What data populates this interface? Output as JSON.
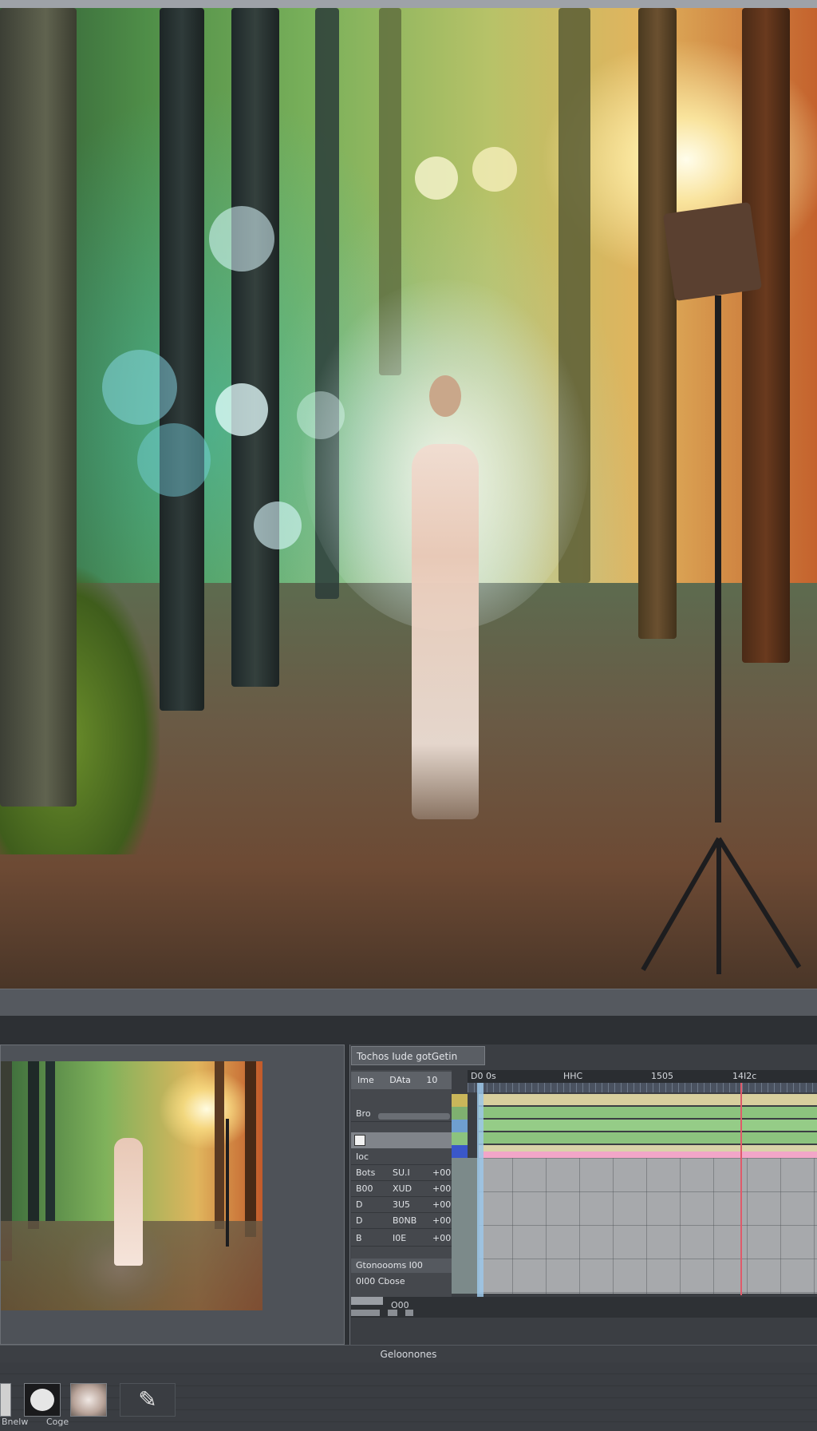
{
  "timeline": {
    "panel_title": "Tochos Iude gotGetin",
    "tabs": [
      "Ime",
      "DAta",
      "10"
    ],
    "props": [
      {
        "k": "Bro",
        "v": "",
        "u": ""
      },
      {
        "k": "Ioc",
        "v": "",
        "u": ""
      },
      {
        "k": "Bots",
        "v": "SU.I",
        "u": "+00"
      },
      {
        "k": "B00",
        "v": "XUD",
        "u": "+00"
      },
      {
        "k": "D",
        "v": "3U5",
        "u": "+00"
      },
      {
        "k": "D",
        "v": "B0NB",
        "u": "+00"
      },
      {
        "k": "B",
        "v": "I0E",
        "u": "+00"
      }
    ],
    "group_1": "Gtonoooms I00",
    "group_2": "0I00 Cbose",
    "bottom_label": "O00",
    "ruler": [
      "D0 0s",
      "HHC",
      "1505",
      "14I2c"
    ]
  },
  "status": {
    "text": "Geloonones"
  },
  "brushes": {
    "labels": [
      "Bnelw",
      "Coge"
    ]
  },
  "icons": {
    "pen": "✎"
  },
  "colors": {
    "accent_playhead": "#9cc7e8",
    "marker_red": "#e05a6a"
  }
}
